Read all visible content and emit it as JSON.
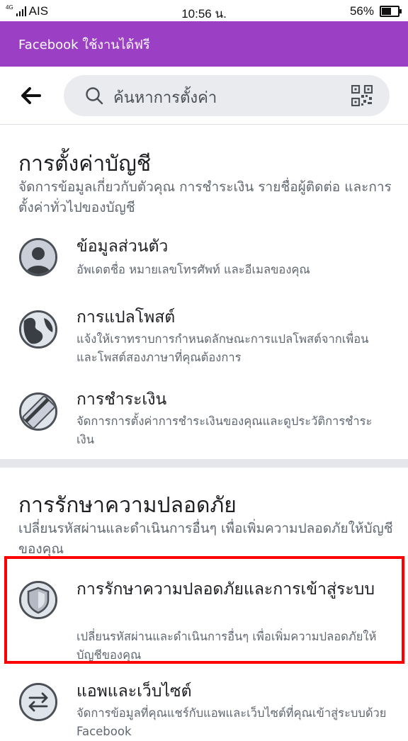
{
  "status_bar": {
    "network": "4G",
    "carrier": "AIS",
    "time": "10:56 น.",
    "battery_percent": "56%",
    "battery_level": 0.56
  },
  "promo": {
    "text": "Facebook ใช้งานได้ฟรี",
    "color": "#9b3fc4"
  },
  "search": {
    "placeholder": "ค้นหาการตั้งค่า"
  },
  "account_settings": {
    "title": "การตั้งค่าบัญชี",
    "description": "จัดการข้อมูลเกี่ยวกับตัวคุณ การชำระเงิน รายชื่อผู้ติดต่อ และการตั้งค่าทั่วไปของบัญชี",
    "items": [
      {
        "icon": "person-icon",
        "title": "ข้อมูลส่วนตัว",
        "desc": "อัพเดตชื่อ หมายเลขโทรศัพท์ และอีเมลของคุณ"
      },
      {
        "icon": "globe-icon",
        "title": "การแปลโพสต์",
        "desc": "แจ้งให้เราทราบการกำหนดลักษณะการแปลโพสต์จากเพื่อนและโพสต์สองภาษาที่คุณต้องการ"
      },
      {
        "icon": "credit-card-icon",
        "title": "การชำระเงิน",
        "desc": "จัดการการตั้งค่าการชำระเงินของคุณและดูประวัติการชำระเงิน"
      }
    ]
  },
  "security_settings": {
    "title": "การรักษาความปลอดภัย",
    "description": "เปลี่ยนรหัสผ่านและดำเนินการอื่นๆ เพื่อเพิ่มความปลอดภัยให้บัญชีของคุณ",
    "items": [
      {
        "icon": "shield-icon",
        "title": "การรักษาความปลอดภัยและการเข้าสู่ระบบ",
        "desc": "เปลี่ยนรหัสผ่านและดำเนินการอื่นๆ เพื่อเพิ่มความปลอดภัยให้บัญชีของคุณ"
      },
      {
        "icon": "arrows-exchange-icon",
        "title": "แอพและเว็บไซต์",
        "desc": "จัดการข้อมูลที่คุณแชร์กับแอพและเว็บไซต์ที่คุณเข้าสู่ระบบด้วย Facebook"
      }
    ]
  },
  "highlight_color": "#ff0000"
}
